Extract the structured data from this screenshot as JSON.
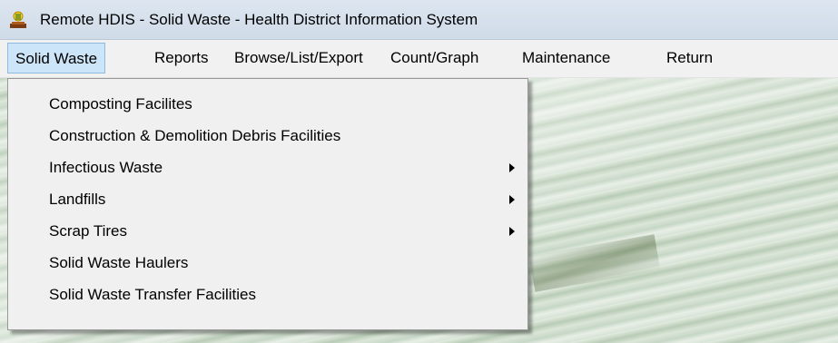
{
  "window": {
    "title": "Remote HDIS - Solid Waste - Health District Information System",
    "icon": "hdis-app-icon"
  },
  "menubar": {
    "items": [
      {
        "label": "Solid Waste",
        "active": true
      },
      {
        "label": "Reports"
      },
      {
        "label": "Browse/List/Export"
      },
      {
        "label": "Count/Graph"
      },
      {
        "label": "Maintenance"
      },
      {
        "label": "Return"
      }
    ]
  },
  "solid_waste_menu": {
    "items": [
      {
        "label": "Composting Facilites",
        "submenu": false
      },
      {
        "label": "Construction & Demolition Debris Facilities",
        "submenu": false
      },
      {
        "label": "Infectious Waste",
        "submenu": true
      },
      {
        "label": "Landfills",
        "submenu": true
      },
      {
        "label": "Scrap Tires",
        "submenu": true
      },
      {
        "label": "Solid Waste Haulers",
        "submenu": false
      },
      {
        "label": "Solid Waste Transfer Facilities",
        "submenu": false
      }
    ]
  },
  "colors": {
    "menu_active_bg": "#cde5f8",
    "menu_active_border": "#8fb9df",
    "titlebar": "#d6e0eb",
    "dropdown_bg": "#f0f0f0"
  }
}
